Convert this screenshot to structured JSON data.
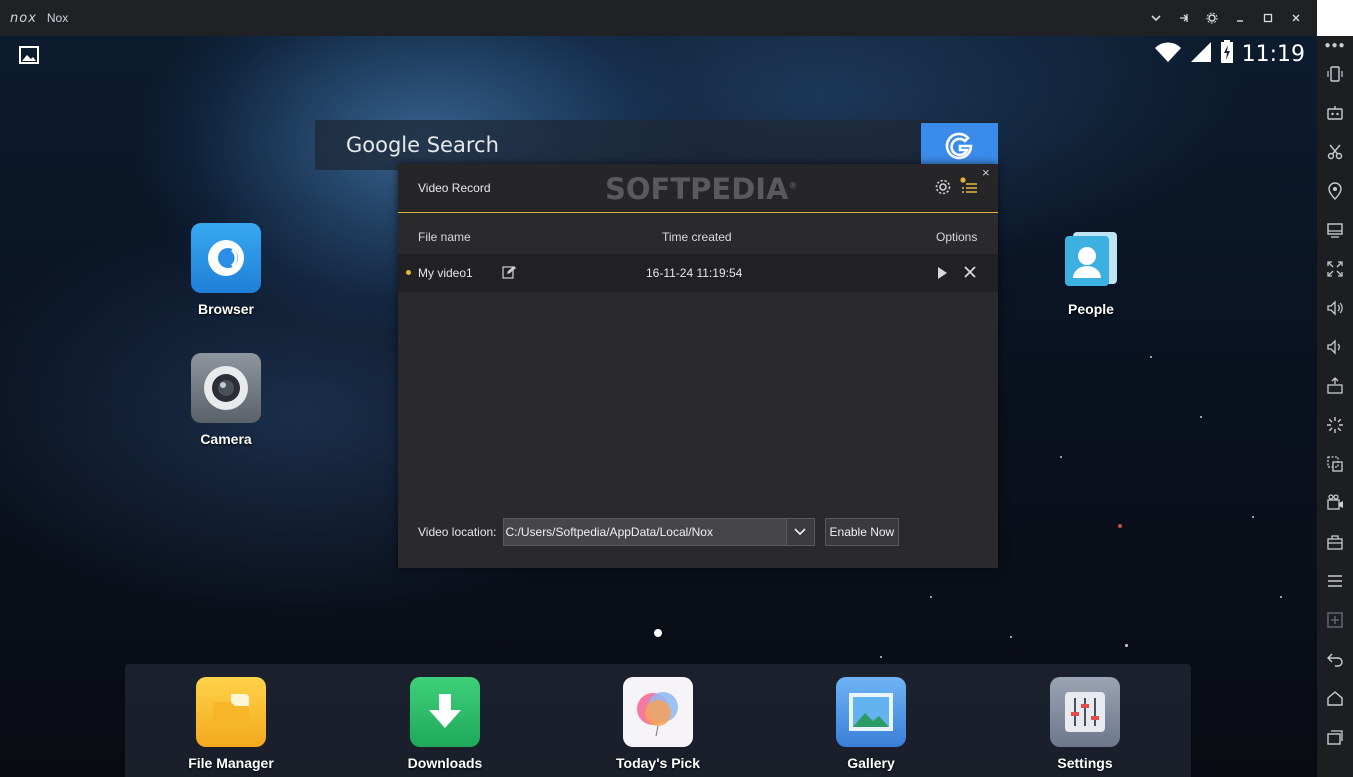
{
  "window": {
    "logo": "nox",
    "title": "Nox",
    "buttons": [
      "chevron-down-icon",
      "pin-icon",
      "gear-icon",
      "minimize-icon",
      "maximize-icon",
      "close-icon"
    ]
  },
  "status_bar": {
    "time": "11:19"
  },
  "search": {
    "label": "Google Search",
    "button_glyph": "G"
  },
  "desktop_apps": [
    {
      "label": "Browser"
    },
    {
      "label": "Camera"
    },
    {
      "label": "People"
    }
  ],
  "dock_apps": [
    {
      "label": "File Manager"
    },
    {
      "label": "Downloads"
    },
    {
      "label": "Today's Pick"
    },
    {
      "label": "Gallery"
    },
    {
      "label": "Settings"
    }
  ],
  "video_record": {
    "title": "Video Record",
    "watermark": "SOFTPEDIA",
    "watermark_mark": "®",
    "close_glyph": "×",
    "columns": {
      "file_name": "File name",
      "time_created": "Time created",
      "options": "Options"
    },
    "rows": [
      {
        "file_name": "My video1",
        "time_created": "16-11-24 11:19:54"
      }
    ],
    "location_label": "Video location:",
    "location_value": "C:/Users/Softpedia/AppData/Local/Nox",
    "enable_button": "Enable Now"
  },
  "sidebar_tools": [
    "phone-shake-icon",
    "robot-icon",
    "scissors-icon",
    "location-icon",
    "screen-icon",
    "fullscreen-icon",
    "volume-up-icon",
    "volume-down-icon",
    "apk-install-icon",
    "loading-icon",
    "multi-instance-icon",
    "record-icon",
    "toolbox-icon",
    "menu-icon",
    "add-icon",
    "back-icon",
    "home-icon",
    "recent-apps-icon"
  ],
  "colors": {
    "accent": "#e0b43a",
    "titlebar": "#1f2124",
    "sidebar": "#1c1e21",
    "google_button": "#3b8beb"
  }
}
